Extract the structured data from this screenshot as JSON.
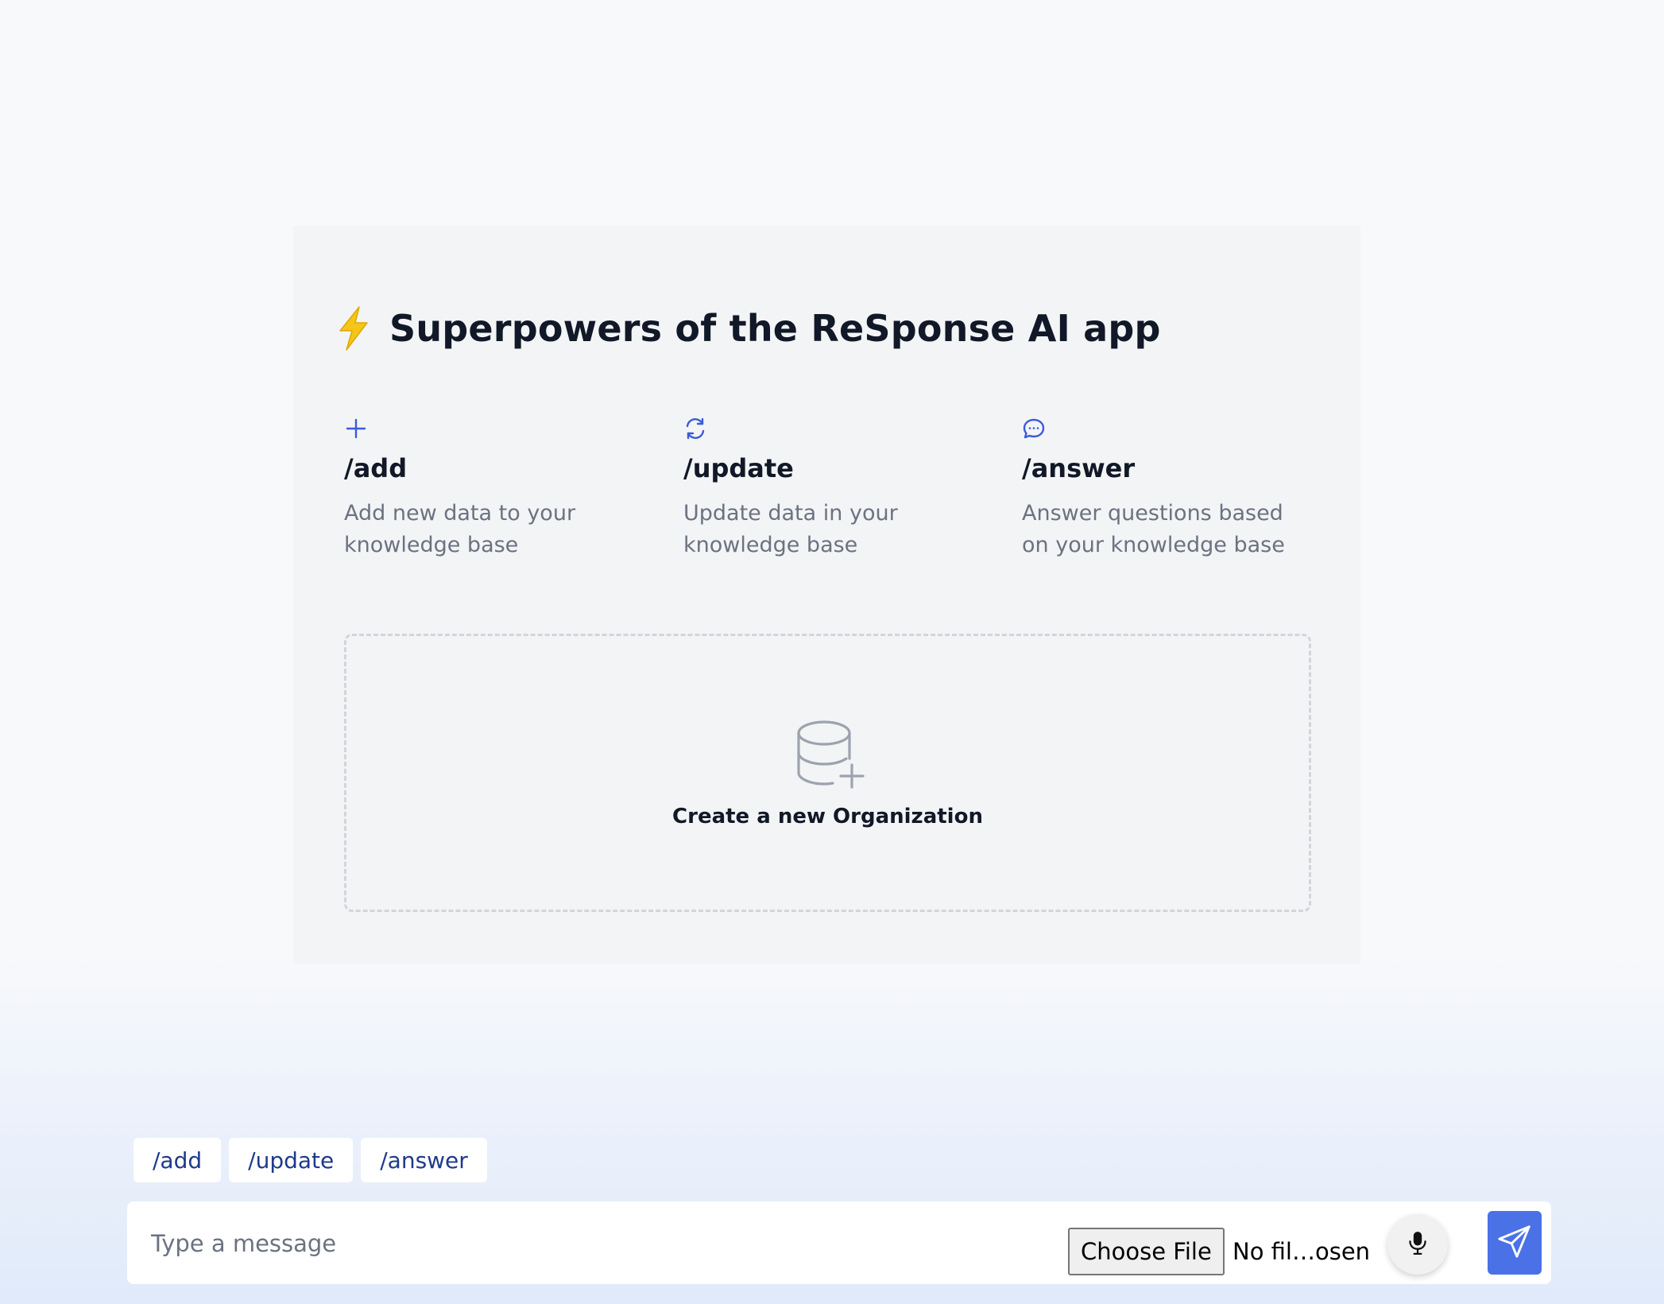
{
  "colors": {
    "accent": "#4a72e6",
    "icon_blue": "#3b5bdb",
    "chip_text": "#1e3a8a",
    "bolt": "#f5c518"
  },
  "card": {
    "title_icon": "lightning-bolt-icon",
    "title": "Superpowers of the ReSponse AI app",
    "features": [
      {
        "icon": "plus-icon",
        "name": "/add",
        "description": "Add new data to your knowledge base"
      },
      {
        "icon": "refresh-icon",
        "name": "/update",
        "description": "Update data in your knowledge base"
      },
      {
        "icon": "chat-bubble-icon",
        "name": "/answer",
        "description": "Answer questions based on your knowledge base"
      }
    ],
    "create_org": {
      "icon": "database-add-icon",
      "label": "Create a new Organization"
    }
  },
  "chips": [
    "/add",
    "/update",
    "/answer"
  ],
  "composer": {
    "placeholder": "Type a message",
    "file_button_label": "Choose File",
    "file_status": "No fil…osen",
    "mic_icon": "microphone-icon",
    "send_icon": "send-icon"
  }
}
